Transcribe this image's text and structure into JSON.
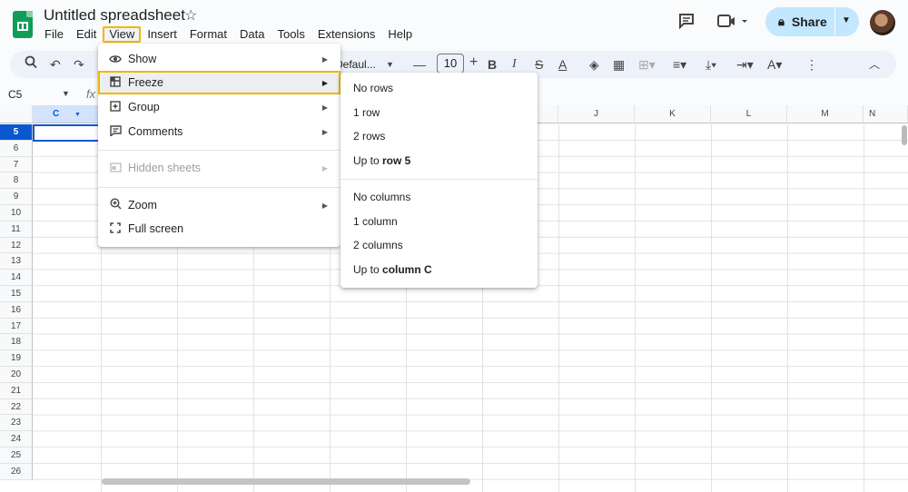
{
  "app": {
    "doc_title": "Untitled spreadsheet",
    "menus": [
      "File",
      "Edit",
      "View",
      "Insert",
      "Format",
      "Data",
      "Tools",
      "Extensions",
      "Help"
    ],
    "share_label": "Share"
  },
  "toolbar": {
    "font_name": "Defaul...",
    "font_size": "10"
  },
  "formula_bar": {
    "cell_ref": "C5",
    "fx": "fx"
  },
  "grid": {
    "columns": [
      "C",
      "J",
      "K",
      "L",
      "M",
      "N"
    ],
    "rows": [
      "5",
      "6",
      "7",
      "8",
      "9",
      "10",
      "11",
      "12",
      "13",
      "14",
      "15",
      "16",
      "17",
      "18",
      "19",
      "20",
      "21",
      "22",
      "23",
      "24",
      "25",
      "26"
    ],
    "selected_column": "C",
    "selected_row": "5"
  },
  "view_menu": {
    "items": [
      {
        "label": "Show",
        "icon": "eye-icon",
        "submenu": true
      },
      {
        "label": "Freeze",
        "icon": "freeze-grid-icon",
        "submenu": true,
        "highlighted": true
      },
      {
        "label": "Group",
        "icon": "group-plus-icon",
        "submenu": true
      },
      {
        "label": "Comments",
        "icon": "comment-icon",
        "submenu": true
      },
      {
        "label": "Hidden sheets",
        "icon": "hidden-sheet-icon",
        "submenu": true,
        "disabled": true
      },
      {
        "label": "Zoom",
        "icon": "zoom-icon",
        "submenu": true
      },
      {
        "label": "Full screen",
        "icon": "fullscreen-icon",
        "submenu": false
      }
    ]
  },
  "freeze_menu": {
    "items": [
      {
        "prefix": "No rows",
        "bold": ""
      },
      {
        "prefix": "1 row",
        "bold": ""
      },
      {
        "prefix": "2 rows",
        "bold": ""
      },
      {
        "prefix": "Up to ",
        "bold": "row 5"
      },
      {
        "prefix": "No columns",
        "bold": ""
      },
      {
        "prefix": "1 column",
        "bold": ""
      },
      {
        "prefix": "2 columns",
        "bold": ""
      },
      {
        "prefix": "Up to ",
        "bold": "column C"
      }
    ]
  },
  "colors": {
    "accent": "#0b57d0",
    "highlight_outline": "#f4b400",
    "share_bg": "#c2e7ff"
  }
}
